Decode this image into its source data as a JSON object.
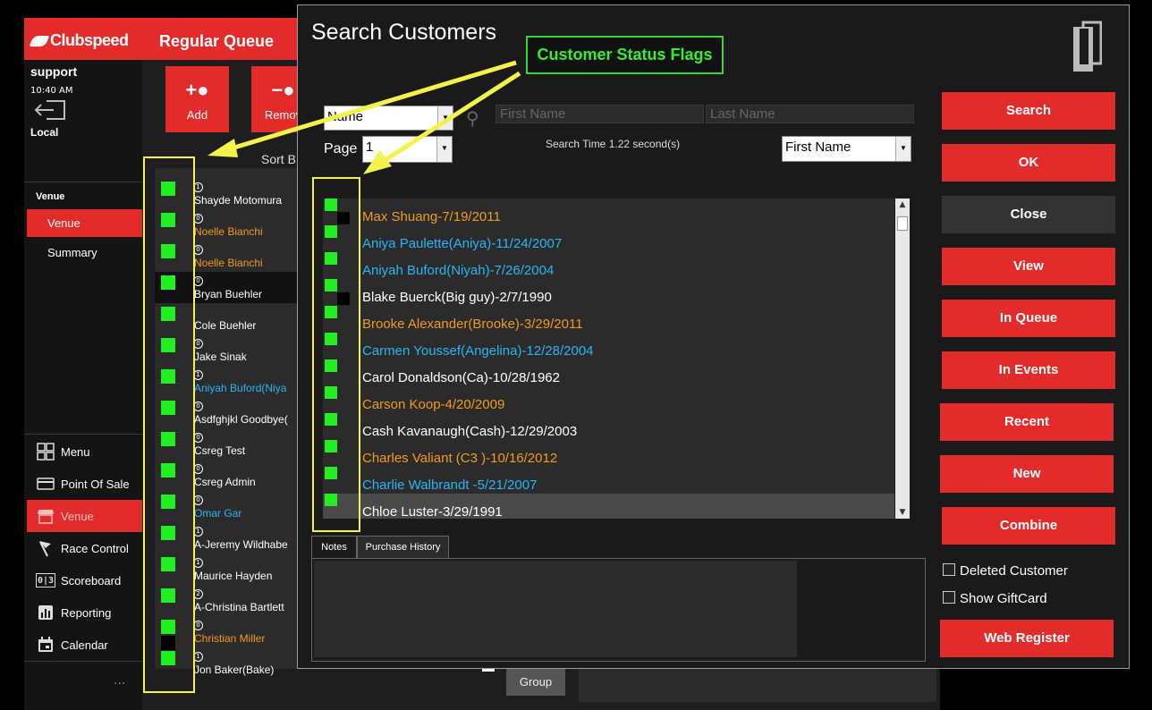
{
  "app": {
    "brand": "Clubspeed",
    "queue_title": "Regular Queue",
    "user": "support",
    "time": "10:40 AM",
    "location": "Local",
    "venue_heading": "Venue",
    "nav_venue": "Venue",
    "nav_summary": "Summary",
    "actions": {
      "add": "Add",
      "remove": "Remov"
    },
    "sort_label": "Sort B",
    "menu": [
      {
        "label": "Menu",
        "icon": "grid-icon"
      },
      {
        "label": "Point Of Sale",
        "icon": "card-icon"
      },
      {
        "label": "Venue",
        "icon": "store-icon",
        "active": true
      },
      {
        "label": "Race Control",
        "icon": "flag-icon"
      },
      {
        "label": "Scoreboard",
        "icon": "scoreboard-icon"
      },
      {
        "label": "Reporting",
        "icon": "chart-icon"
      },
      {
        "label": "Calendar",
        "icon": "calendar-icon"
      }
    ],
    "more": "...",
    "group_button": "Group",
    "queue": [
      {
        "num": "1",
        "name": "Shayde Motomura",
        "color": "#ffffff"
      },
      {
        "num": "0",
        "name": "Noelle Bianchi",
        "color": "#f39a1e"
      },
      {
        "num": "0",
        "name": "Noelle Bianchi",
        "color": "#f39a1e"
      },
      {
        "num": "0",
        "name": "Bryan Buehler",
        "color": "#ffffff",
        "selected": true
      },
      {
        "num": "",
        "name": "Cole Buehler",
        "color": "#ffffff"
      },
      {
        "num": "0",
        "name": "Jake Sinak",
        "color": "#ffffff"
      },
      {
        "num": "1",
        "name": "Aniyah Buford(Niya",
        "color": "#29b6f6"
      },
      {
        "num": "0",
        "name": "Asdfghjkl Goodbye(",
        "color": "#ffffff"
      },
      {
        "num": "0",
        "name": "Csreg Test",
        "color": "#ffffff"
      },
      {
        "num": "0",
        "name": "Csreg Admin",
        "color": "#ffffff"
      },
      {
        "num": "0",
        "name": "Omar Gar",
        "color": "#29b6f6"
      },
      {
        "num": "1",
        "name": "A-Jeremy Wildhabe",
        "color": "#ffffff"
      },
      {
        "num": "1",
        "name": "Maurice Hayden",
        "color": "#ffffff"
      },
      {
        "num": "2",
        "name": "A-Christina Bartlett",
        "color": "#ffffff"
      },
      {
        "num": "0",
        "name": "Christian Miller",
        "color": "#f39a1e"
      },
      {
        "num": "1",
        "name": "Jon Baker(Bake)",
        "color": "#ffffff"
      }
    ]
  },
  "dialog": {
    "title": "Search Customers",
    "search_by": "Name",
    "first_name_placeholder": "First Name",
    "last_name_placeholder": "Last Name",
    "page_label": "Page",
    "page_value": "1",
    "search_time": "Search Time 1.22 second(s)",
    "sort_by": "First Name",
    "results": [
      {
        "name": "Max Shuang-7/19/2011",
        "color": "#f39a1e",
        "dark_flag": true
      },
      {
        "name": "Aniya Paulette(Aniya)-11/24/2007",
        "color": "#29b6f6"
      },
      {
        "name": "Aniyah Buford(Niyah)-7/26/2004",
        "color": "#29b6f6"
      },
      {
        "name": "Blake Buerck(Big guy)-2/7/1990",
        "color": "#ffffff",
        "dark_flag": true
      },
      {
        "name": "Brooke Alexander(Brooke)-3/29/2011",
        "color": "#f39a1e"
      },
      {
        "name": "Carmen Youssef(Angelina)-12/28/2004",
        "color": "#29b6f6"
      },
      {
        "name": "Carol Donaldson(Ca)-10/28/1962",
        "color": "#ffffff"
      },
      {
        "name": "Carson Koop-4/20/2009",
        "color": "#f39a1e"
      },
      {
        "name": "Cash Kavanaugh(Cash)-12/29/2003",
        "color": "#ffffff"
      },
      {
        "name": "Charles  Valiant (C3 )-10/16/2012",
        "color": "#f39a1e"
      },
      {
        "name": "Charlie   Walbrandt -5/21/2007",
        "color": "#29b6f6"
      },
      {
        "name": "Chloe Luster-3/29/1991",
        "color": "#ffffff",
        "selected": true
      }
    ],
    "tabs": [
      "Notes",
      "Purchase History"
    ],
    "buttons": {
      "search": "Search",
      "ok": "OK",
      "close": "Close",
      "view": "View",
      "in_queue": "In Queue",
      "in_events": "In Events",
      "recent": "Recent",
      "new": "New",
      "combine": "Combine",
      "web_register": "Web Register"
    },
    "checkboxes": {
      "deleted_customer": "Deleted Customer",
      "show_giftcard": "Show GiftCard"
    }
  },
  "annotation": {
    "callout": "Customer Status Flags"
  },
  "colors": {
    "accent": "#e32b2b",
    "flag_green": "#22ee22",
    "highlight_yellow": "#f3f34a",
    "callout_green": "#33ee33"
  }
}
